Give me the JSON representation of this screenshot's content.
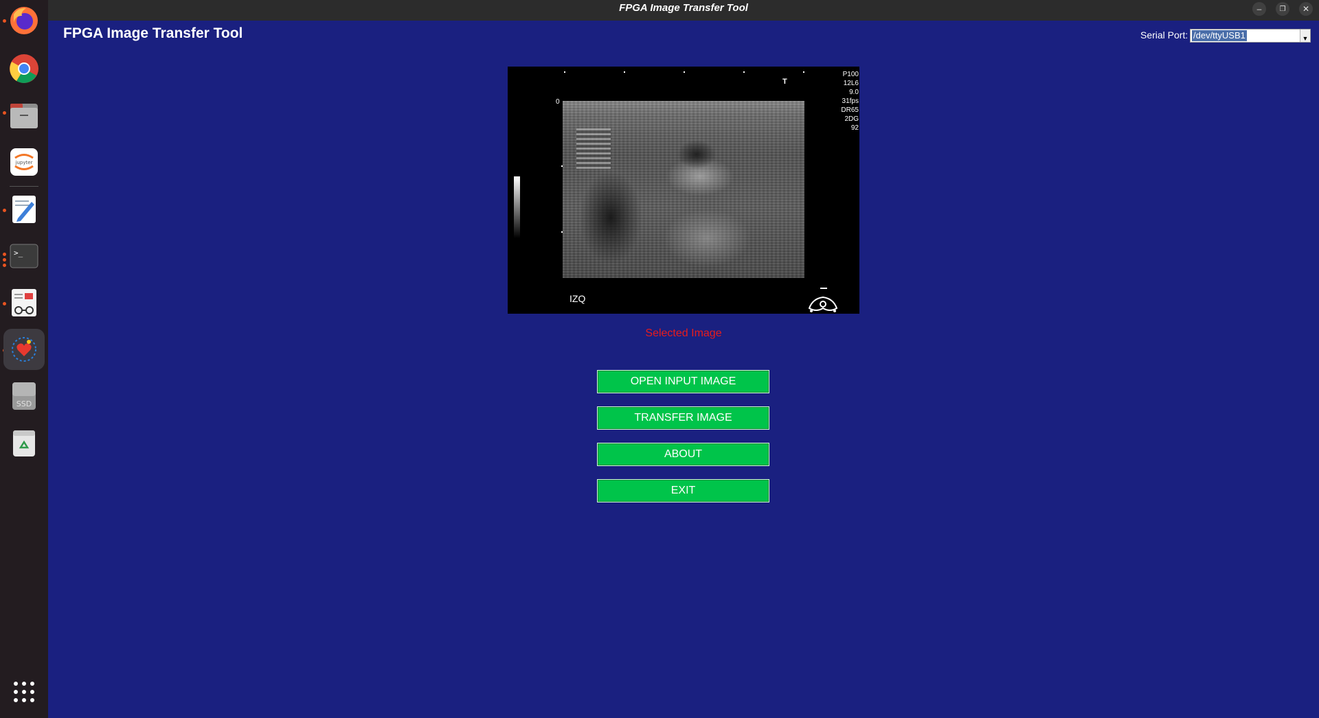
{
  "window": {
    "title": "FPGA Image Transfer Tool",
    "controls": [
      "minimize-icon",
      "maximize-icon",
      "close-icon"
    ]
  },
  "dock": {
    "items": [
      {
        "name": "firefox-icon"
      },
      {
        "name": "chrome-icon"
      },
      {
        "name": "files-icon"
      },
      {
        "name": "jupyter-icon",
        "label": "jupyter"
      },
      {
        "name": "text-editor-icon"
      },
      {
        "name": "terminal-icon"
      },
      {
        "name": "document-viewer-icon"
      },
      {
        "name": "app-icon"
      },
      {
        "name": "ssd-drive-icon",
        "label": "SSD"
      },
      {
        "name": "trash-icon"
      },
      {
        "name": "show-apps-icon"
      }
    ]
  },
  "app": {
    "title": "FPGA Image Transfer Tool",
    "serial_port": {
      "label": "Serial Port:",
      "value": "/dev/ttyUSB1"
    },
    "image": {
      "overlay": {
        "marker": "T",
        "depth_zero": "0",
        "params": [
          "P100",
          "12L6",
          "9.0",
          "31fps",
          "DR65",
          "2DG",
          "92"
        ],
        "side_label": "IZQ"
      },
      "caption": "Selected Image",
      "caption_color": "#e81c1c"
    },
    "buttons": {
      "open": "OPEN INPUT IMAGE",
      "transfer": "TRANSFER IMAGE",
      "about": "ABOUT",
      "exit": "EXIT"
    },
    "colors": {
      "background": "#1a2080",
      "button": "#00c44a"
    }
  }
}
